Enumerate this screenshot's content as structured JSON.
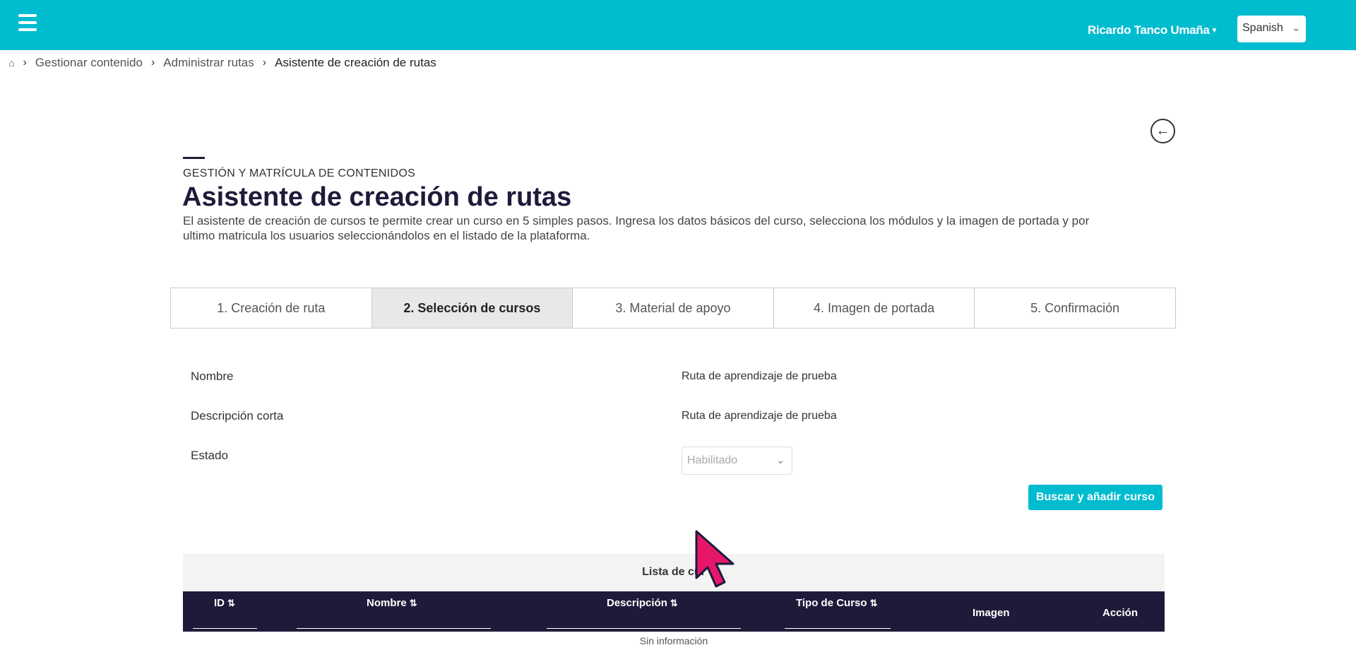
{
  "header": {
    "user_name": "Ricardo Tanco Umaña",
    "language": "Spanish",
    "colors": {
      "topbar": "#00bccf",
      "dark": "#1e1b3a"
    }
  },
  "breadcrumb": {
    "items": [
      "Gestionar contenido",
      "Administrar rutas"
    ],
    "current": "Asistente de creación de rutas"
  },
  "page": {
    "eyebrow": "GESTIÓN Y MATRÍCULA DE CONTENIDOS",
    "title": "Asistente de creación de rutas",
    "description": "El asistente de creación de cursos te permite crear un curso en 5 simples pasos. Ingresa los datos básicos del curso, selecciona los módulos y la imagen de portada y por ultimo matricula los usuarios seleccionándolos en el listado de la plataforma."
  },
  "tabs": [
    {
      "label": "1. Creación de ruta",
      "active": false
    },
    {
      "label": "2. Selección de cursos",
      "active": true
    },
    {
      "label": "3. Material de apoyo",
      "active": false
    },
    {
      "label": "4. Imagen de portada",
      "active": false
    },
    {
      "label": "5. Confirmación",
      "active": false
    }
  ],
  "form": {
    "name_label": "Nombre",
    "name_value": "Ruta de aprendizaje de prueba",
    "short_desc_label": "Descripción corta",
    "short_desc_value": "Ruta de aprendizaje de prueba",
    "status_label": "Estado",
    "status_value": "Habilitado"
  },
  "actions": {
    "add_course": "Buscar y añadir curso"
  },
  "table": {
    "title": "Lista de cur",
    "columns": {
      "id": "ID",
      "name": "Nombre",
      "description": "Descripción",
      "course_type": "Tipo de Curso",
      "image": "Imagen",
      "action": "Acción"
    },
    "empty_text": "Sin información"
  }
}
